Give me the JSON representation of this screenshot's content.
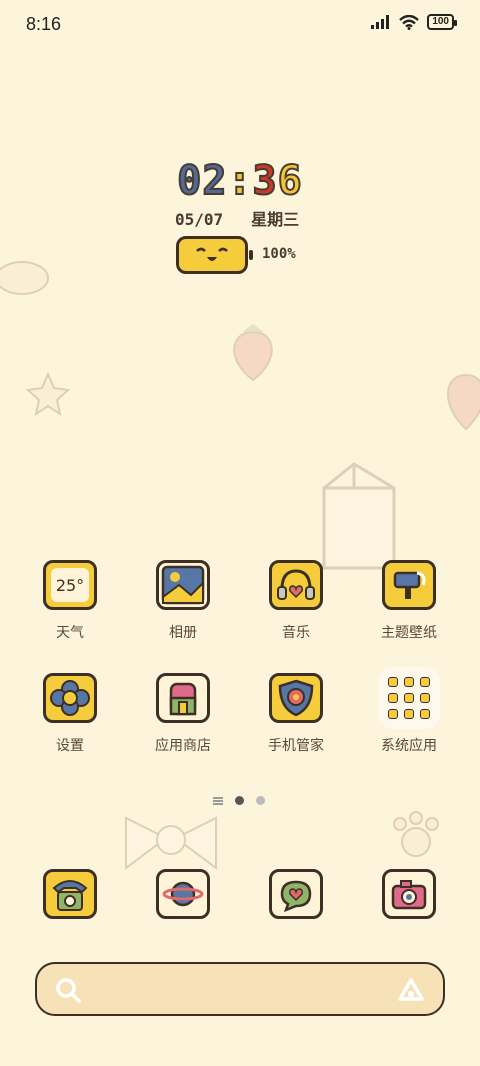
{
  "status_bar": {
    "time": "8:16",
    "battery": "100",
    "icons": [
      "signal-icon",
      "wifi-icon",
      "battery-icon"
    ]
  },
  "clock_widget": {
    "hour": "02",
    "separator": ":",
    "min_tens": "3",
    "min_ones": "6",
    "date": "05/07",
    "weekday": "星期三",
    "battery_percent": "100%"
  },
  "apps_row1": [
    {
      "label": "天气",
      "icon": "weather-icon",
      "temp": "25°"
    },
    {
      "label": "相册",
      "icon": "gallery-icon"
    },
    {
      "label": "音乐",
      "icon": "music-icon"
    },
    {
      "label": "主题壁纸",
      "icon": "theme-icon"
    }
  ],
  "apps_row2": [
    {
      "label": "设置",
      "icon": "settings-icon"
    },
    {
      "label": "应用商店",
      "icon": "app-store-icon"
    },
    {
      "label": "手机管家",
      "icon": "security-icon"
    },
    {
      "label": "系统应用",
      "icon": "folder-icon"
    }
  ],
  "dock": [
    {
      "icon": "phone-icon"
    },
    {
      "icon": "browser-icon"
    },
    {
      "icon": "messages-icon"
    },
    {
      "icon": "camera-icon"
    }
  ],
  "page_indicator": {
    "pages": 2,
    "active": 1
  },
  "search_bar": {
    "icons": [
      "search-icon",
      "assistant-icon"
    ]
  }
}
